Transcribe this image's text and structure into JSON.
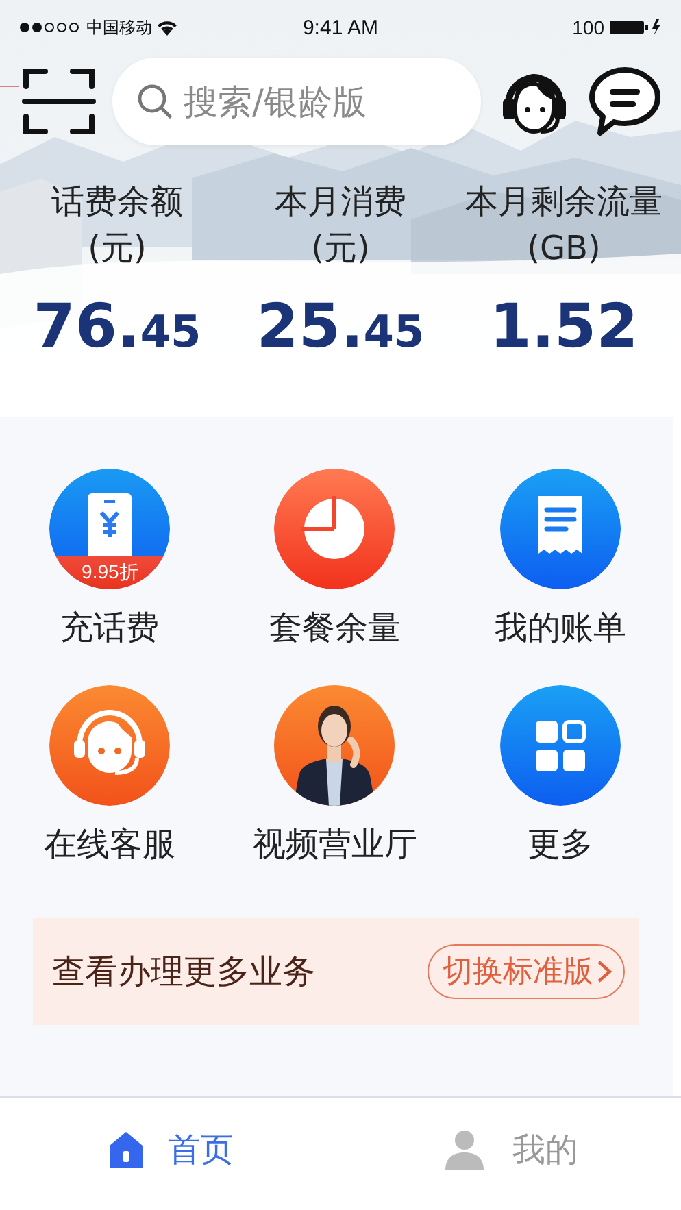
{
  "status_bar": {
    "carrier": "中国移动",
    "time": "9:41 AM",
    "battery": "100"
  },
  "header": {
    "search": {
      "placeholder": "搜索/银龄版"
    }
  },
  "stats": [
    {
      "label": "话费余额",
      "unit": "(元)",
      "value": "76.45",
      "small_decimals": true
    },
    {
      "label": "本月消费",
      "unit": "(元)",
      "value": "25.45",
      "small_decimals": true
    },
    {
      "label": "本月剩余流量",
      "unit": "(GB)",
      "value": "1.52",
      "small_decimals": false
    }
  ],
  "services": [
    {
      "kind": "recharge",
      "label": "充话费",
      "badge": "9.95折"
    },
    {
      "kind": "usage",
      "label": "套餐余量"
    },
    {
      "kind": "bill",
      "label": "我的账单"
    },
    {
      "kind": "support",
      "label": "在线客服"
    },
    {
      "kind": "video",
      "label": "视频营业厅"
    },
    {
      "kind": "more",
      "label": "更多"
    }
  ],
  "banner": {
    "text": "查看办理更多业务",
    "button": "切换标准版"
  },
  "tabs": [
    {
      "kind": "home",
      "label": "首页",
      "selected": true
    },
    {
      "kind": "me",
      "label": "我的",
      "selected": false
    }
  ]
}
